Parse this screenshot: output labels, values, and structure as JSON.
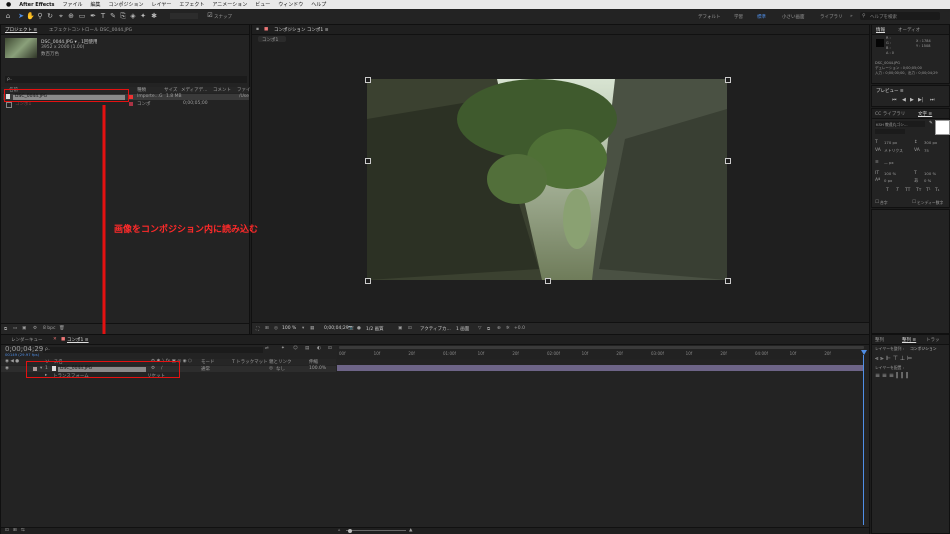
{
  "menubar": {
    "apple_icon": "apple-icon",
    "app_name": "After Effects",
    "items": [
      "ファイル",
      "編集",
      "コンポジション",
      "レイヤー",
      "エフェクト",
      "アニメーション",
      "ビュー",
      "ウィンドウ",
      "ヘルプ"
    ]
  },
  "toolbar": {
    "snap_label": "スナップ",
    "workspaces": [
      "デフォルト",
      "学習",
      "標準",
      "小さい画面",
      "ライブラリ"
    ],
    "search_placeholder": "ヘルプを検索"
  },
  "project_panel": {
    "tab_project": "プロジェクト ≡",
    "tab_effects": "エフェクトコントロール DSC_0044.JPG",
    "thumb_name": "DSC_0044.JPG ▾ , 1回使用",
    "thumb_size": "3952 x 2000 (1.00)",
    "thumb_color": "数百万色",
    "search_value": "ρ₋",
    "col_name": "名前",
    "col_type": "種類",
    "col_size": "サイズ",
    "col_media": "メディアデ...",
    "col_comment": "コメント",
    "col_file": "ファイ",
    "rows": [
      {
        "name": "DSC_0044.JPG",
        "type": "Importe...G",
        "size": "1.8 MB",
        "file": "/Use"
      },
      {
        "name": "コンポ1",
        "type": "コンポ",
        "media": "0;00;05;00",
        "file": ""
      }
    ],
    "bpc": "8 bpc"
  },
  "comp_panel": {
    "tab_label": "コンポジション コンポ1 ≡",
    "sub_tab": "コンポ1",
    "zoom": "100 %",
    "timecode": "0;00;04;29",
    "resolution": "1/2 画質",
    "camera": "アクティブカ...",
    "views": "1 画面",
    "offset": "+0.0"
  },
  "annotation": {
    "text": "画像をコンポジション内に読み込む",
    "color": "#ff2a2a"
  },
  "info_panel": {
    "tab_info": "情報",
    "tab_audio": "オーディオ",
    "rgb_labels": [
      "R :",
      "G :",
      "B :",
      "A : 0"
    ],
    "x_readout": "X : 1784",
    "y_readout": "Y : 1508",
    "file_name": "DSC_0044.JPG",
    "duration": "デュレーション : 0;00;05;00",
    "in_out": "入力 : 0;00;00;00、出力 : 0;00;04;29"
  },
  "preview_panel": {
    "title": "プレビュー ≡"
  },
  "character_panel": {
    "tab_libraries": "CC ライブラリ",
    "tab_character": "文字 ≡",
    "font_name": "KSH 教遥丸ゴシ...",
    "font_size": "170 px",
    "leading": "300 px",
    "kerning": "メトリクス",
    "tracking": "75",
    "stroke": "— px",
    "vscale": "100 %",
    "hscale": "100 %",
    "baseline": "0 px",
    "tsume": "0 %",
    "styles": [
      "T",
      "T",
      "TT",
      "Tт",
      "T¹",
      "T₁"
    ],
    "check_ligature": "合字",
    "check_hindi": "ヒンディー数字"
  },
  "timeline": {
    "tab_render": "レンダーキュー",
    "tab_comp": "コンポ1 ≡",
    "timecode": "0;00;04;29",
    "fps": "00149 (29.97 fps)",
    "search_value": "ρ₋",
    "col_source": "ソース名",
    "col_mode": "モード",
    "col_trkmat": "T トラックマット",
    "col_parent": "親とリンク",
    "col_stretch": "伸縮",
    "layer_number": "1",
    "layer_name": "DSC_0044.JPG",
    "layer_mode": "通常",
    "layer_parent": "なし",
    "layer_stretch": "100.0%",
    "transform_label": "トランスフォーム",
    "transform_value": "リセット",
    "ruler_labels": [
      "00f",
      "10f",
      "20f",
      "01:00f",
      "10f",
      "20f",
      "02:00f",
      "10f",
      "20f",
      "03:00f",
      "10f",
      "20f",
      "04:00f",
      "10f",
      "20f"
    ]
  },
  "paragraph_panel": {
    "tab_align": "整列",
    "tab_paragraph": "整列 ≡",
    "tab_tracker": "トラッ",
    "align_to_label": "レイヤーを整列 :",
    "align_to_value": "コンポジション",
    "distribute_label": "レイヤーを配置 :"
  }
}
